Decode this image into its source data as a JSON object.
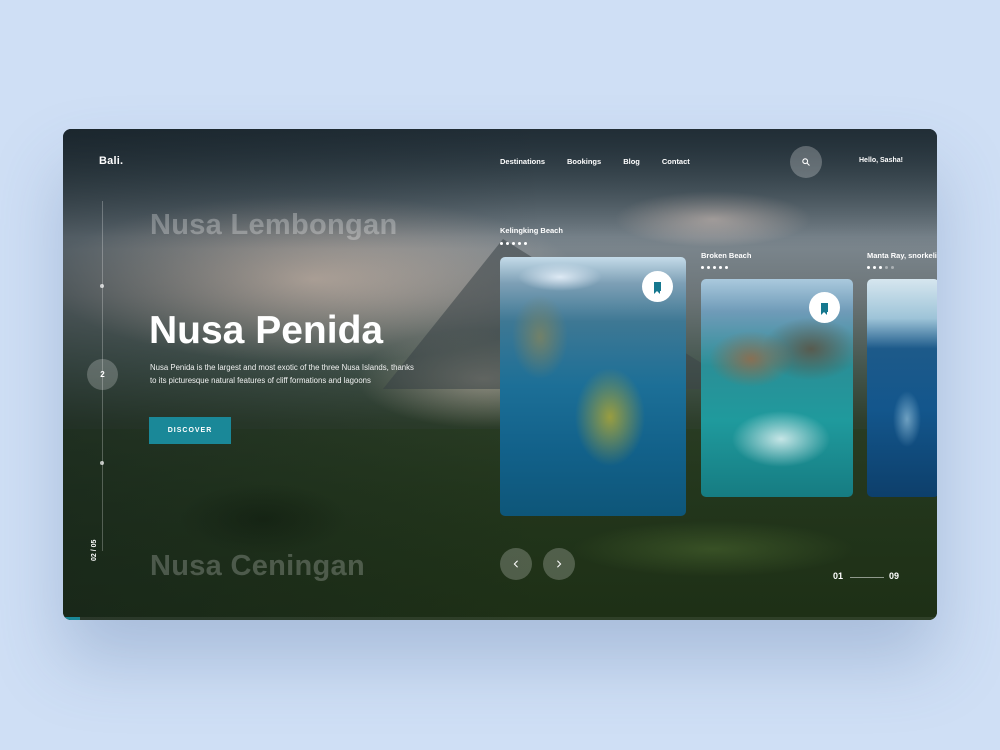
{
  "brand": "Bali.",
  "nav": [
    "Destinations",
    "Bookings",
    "Blog",
    "Contact"
  ],
  "greeting": "Hello, Sasha!",
  "slide": {
    "current_circle": "2",
    "counter": "02 / 05"
  },
  "hero": {
    "prev_title": "Nusa Lembongan",
    "title": "Nusa Penida",
    "next_title": "Nusa Ceningan",
    "description": "Nusa Penida is the largest and most exotic of the three Nusa Islands, thanks to its picturesque natural features of cliff formations and lagoons",
    "button": "DISCOVER"
  },
  "cards": [
    {
      "title": "Kelingking Beach",
      "dots_total": 5,
      "dots_active": 5
    },
    {
      "title": "Broken Beach",
      "dots_total": 5,
      "dots_active": 5
    },
    {
      "title": "Manta Ray, snorkeling",
      "dots_total": 5,
      "dots_active": 3
    }
  ],
  "pager": {
    "start": "01",
    "end": "09"
  },
  "progress": 0.02,
  "icons": {
    "search": "search-icon",
    "bookmark": "bookmark-icon",
    "prev": "chevron-left-icon",
    "next": "chevron-right-icon"
  },
  "colors": {
    "accent": "#1a8898",
    "background": "#cfdff5"
  }
}
